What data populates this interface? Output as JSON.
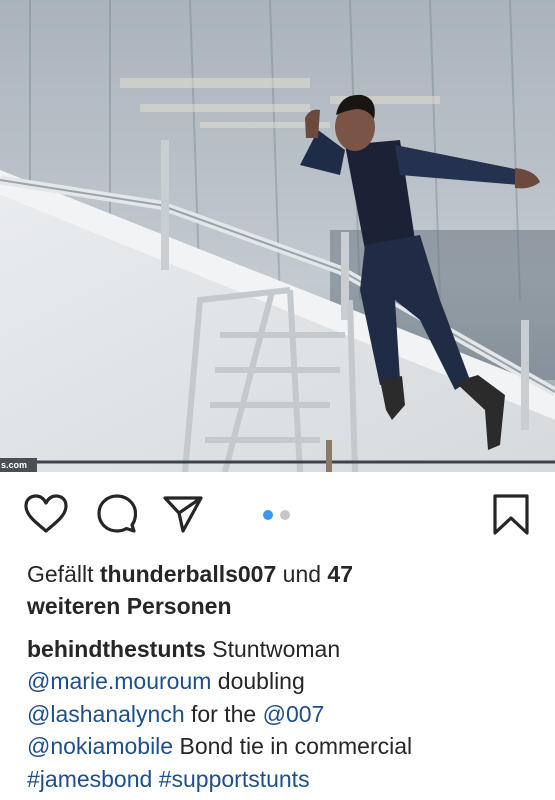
{
  "photo": {
    "alt_subject": "stuntwoman jumping over railing",
    "watermark_text": "s.com"
  },
  "actions": {
    "like_icon": "heart-icon",
    "comment_icon": "comment-icon",
    "share_icon": "paper-plane-icon",
    "save_icon": "bookmark-icon",
    "carousel": {
      "count": 2,
      "active_index": 0
    }
  },
  "likes": {
    "prefix": "Gefällt",
    "user": "thunderballs007",
    "conjunction": "und",
    "count": "47",
    "suffix": "weiteren Personen"
  },
  "caption": {
    "username": "behindthestunts",
    "text1": "Stuntwoman",
    "mention1": "@marie.mouroum",
    "text2": "doubling",
    "mention2": "@lashanalynch",
    "text3": "for the",
    "mention3": "@007",
    "mention4": "@nokiamobile",
    "text4": "Bond tie in commercial",
    "hashtag1": "#jamesbond",
    "hashtag2": "#supportstunts"
  },
  "colors": {
    "text": "#262626",
    "link": "#1d4f8c",
    "dot_active": "#3897f0",
    "dot_inactive": "#c7c7c7"
  }
}
